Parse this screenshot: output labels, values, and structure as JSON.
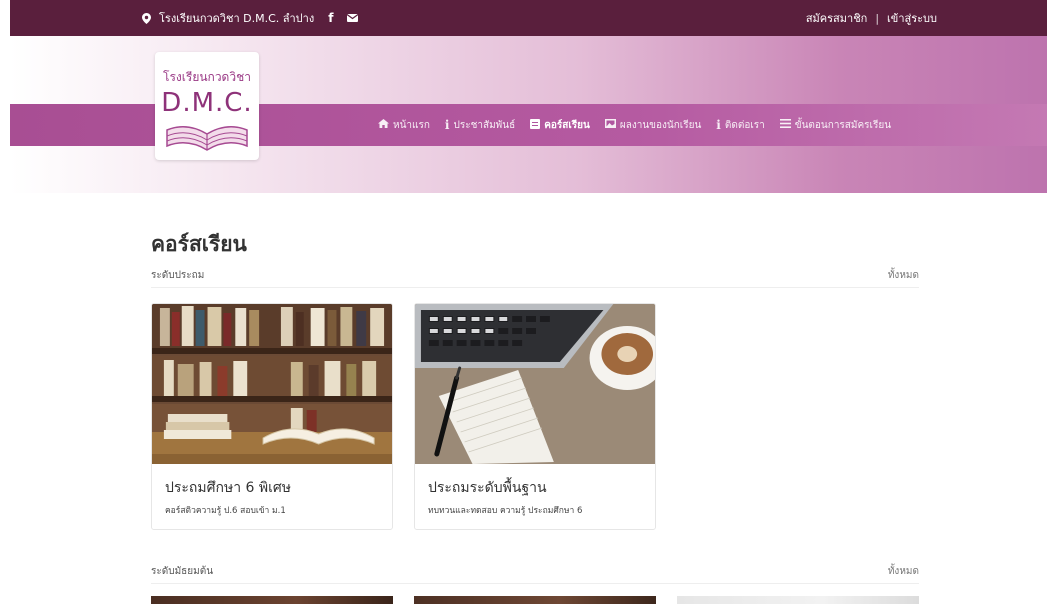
{
  "topbar": {
    "school_name": "โรงเรียนกวดวิชา D.M.C. ลำปาง",
    "register": "สมัครสมาชิก",
    "separator": "|",
    "login": "เข้าสู่ระบบ"
  },
  "logo": {
    "line1": "โรงเรียนกวดวิชา",
    "line2": "D.M.C."
  },
  "nav": [
    {
      "label": "หน้าแรก",
      "icon": "home-icon"
    },
    {
      "label": "ประชาสัมพันธ์",
      "icon": "info-icon"
    },
    {
      "label": "คอร์สเรียน",
      "icon": "book-icon"
    },
    {
      "label": "ผลงานของนักเรียน",
      "icon": "image-icon"
    },
    {
      "label": "ติดต่อเรา",
      "icon": "info-icon"
    },
    {
      "label": "ขั้นตอนการสมัครเรียน",
      "icon": "list-icon"
    }
  ],
  "main": {
    "title": "คอร์สเรียน",
    "sections": [
      {
        "title": "ระดับประถม",
        "all_label": "ทั้งหมด",
        "cards": [
          {
            "title": "ประถมศึกษา 6 พิเศษ",
            "subtitle": "คอร์สติวความรู้ ป.6 สอบเข้า ม.1"
          },
          {
            "title": "ประถมระดับพื้นฐาน",
            "subtitle": "ทบทวนและทดสอบ ความรู้ ประถมศึกษา 6"
          }
        ]
      },
      {
        "title": "ระดับมัธยมต้น",
        "all_label": "ทั้งหมด"
      }
    ]
  },
  "colors": {
    "topbar": "#5a1f3d",
    "nav_band": "#b055a0",
    "accent": "#8e3279"
  }
}
